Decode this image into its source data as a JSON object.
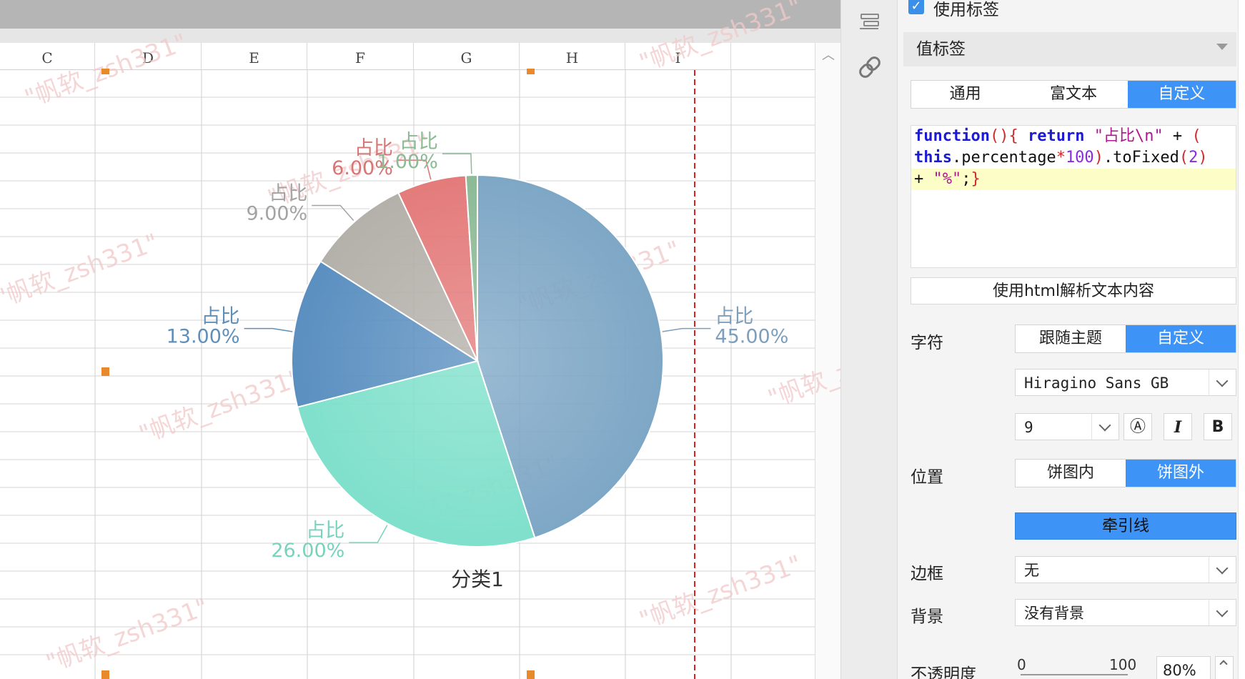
{
  "sheet": {
    "columns": [
      "C",
      "D",
      "E",
      "F",
      "G",
      "H",
      "I"
    ]
  },
  "watermark_text": "\"帆软_zsh331\"",
  "chart_data": {
    "type": "pie",
    "categories": [
      "占比",
      "占比",
      "占比",
      "占比",
      "占比",
      "占比"
    ],
    "series": [
      {
        "name": "分类1",
        "values": [
          45,
          26,
          13,
          9,
          6,
          1
        ],
        "labels": [
          "45.00%",
          "26.00%",
          "13.00%",
          "9.00%",
          "6.00%",
          "1.00%"
        ]
      }
    ],
    "label_prefix": "占比",
    "title": "分类1",
    "colors": [
      "#7ea7c6",
      "#7fe0cb",
      "#5a8fc0",
      "#b4b0aa",
      "#e47b7b",
      "#8dba96"
    ],
    "label_colors": [
      "#7d9fbb",
      "#78d3bd",
      "#5f8fb9",
      "#a3a3a3",
      "#d77474",
      "#8bba93"
    ],
    "legend": "none",
    "grid": false
  },
  "toolstrip": {
    "icons": [
      "list-settings-icon",
      "link-icon"
    ]
  },
  "panel": {
    "use_label": "使用标签",
    "section_title": "值标签",
    "label_tabs": [
      "通用",
      "富文本",
      "自定义"
    ],
    "label_tabs_active": 2,
    "code_lines": [
      [
        {
          "t": "kw",
          "v": "function"
        },
        {
          "t": "punc",
          "v": "()"
        },
        {
          "t": "punc",
          "v": "{"
        },
        {
          "t": "plain",
          "v": " "
        },
        {
          "t": "kw",
          "v": "return"
        },
        {
          "t": "plain",
          "v": " "
        },
        {
          "t": "str",
          "v": "\"占比\\n\""
        },
        {
          "t": "plain",
          "v": " + "
        },
        {
          "t": "punc",
          "v": "("
        }
      ],
      [
        {
          "t": "kw",
          "v": "this"
        },
        {
          "t": "plain",
          "v": ".percentage"
        },
        {
          "t": "punc",
          "v": "*"
        },
        {
          "t": "num",
          "v": "100"
        },
        {
          "t": "punc",
          "v": ")"
        },
        {
          "t": "plain",
          "v": ".toFixed"
        },
        {
          "t": "punc",
          "v": "("
        },
        {
          "t": "num",
          "v": "2"
        },
        {
          "t": "punc",
          "v": ")"
        }
      ],
      [
        {
          "t": "plain",
          "v": "+ "
        },
        {
          "t": "str",
          "v": "\"%\""
        },
        {
          "t": "plain",
          "v": ";"
        },
        {
          "t": "punc",
          "v": "}"
        }
      ]
    ],
    "html_button": "使用html解析文本内容",
    "char_label": "字符",
    "char_tabs": [
      "跟随主题",
      "自定义"
    ],
    "char_tabs_active": 1,
    "font_name": "Hiragino Sans GB",
    "font_size": "9",
    "format_buttons": [
      "Ⓐ",
      "I",
      "B"
    ],
    "position_label": "位置",
    "position_tabs": [
      "饼图内",
      "饼图外"
    ],
    "position_tabs_active": 1,
    "leader_button": "牵引线",
    "border_label": "边框",
    "border_value": "无",
    "background_label": "背景",
    "background_value": "没有背景",
    "opacity_label": "不透明度",
    "opacity_min": "0",
    "opacity_max": "100",
    "opacity_value": "80%"
  }
}
